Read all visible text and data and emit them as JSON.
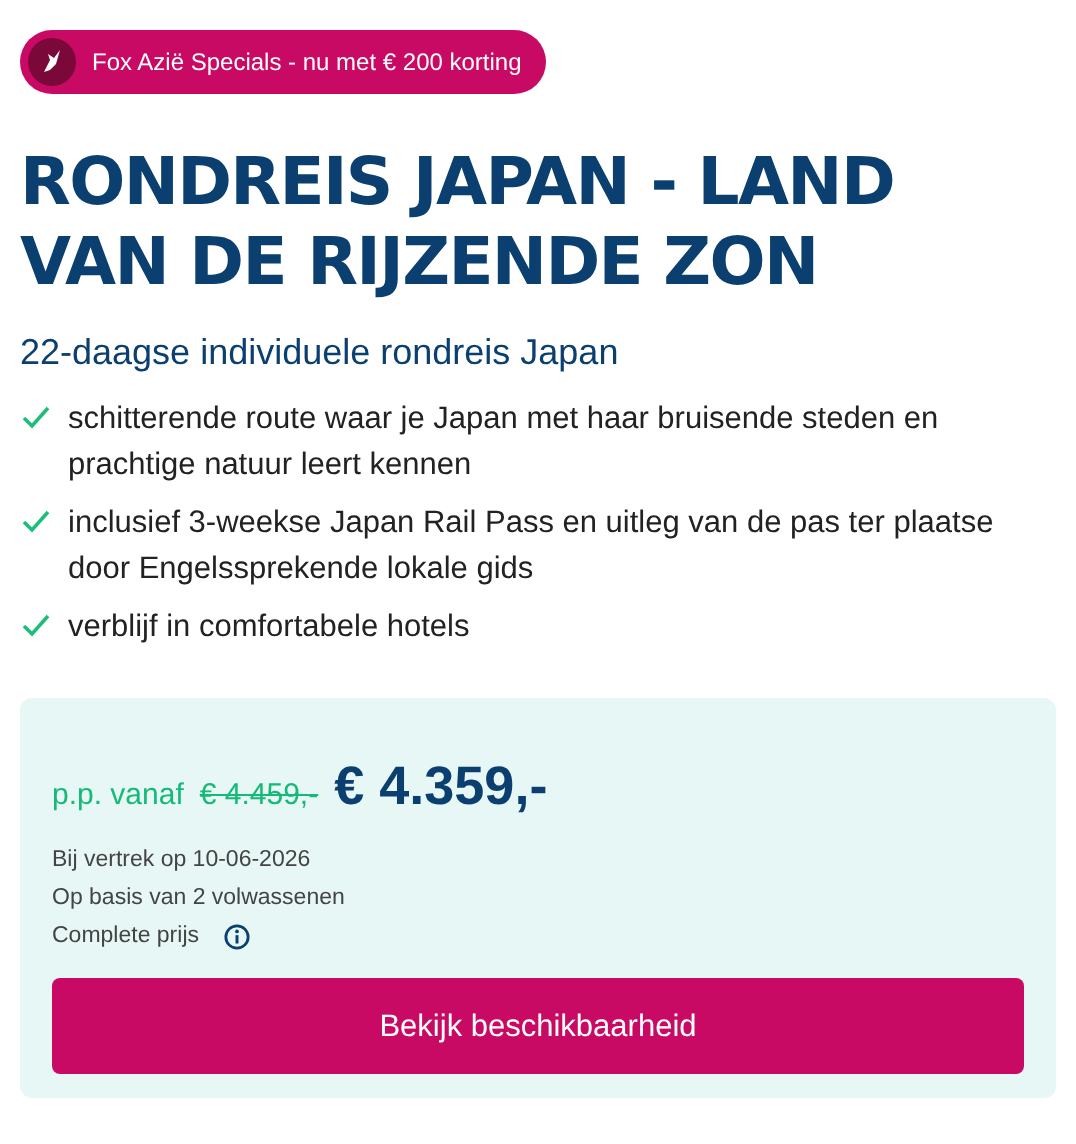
{
  "badge": {
    "label": "Fox Azië Specials - nu met € 200 korting"
  },
  "title": "RONDREIS JAPAN - LAND VAN DE RIJZENDE ZON",
  "subtitle": "22-daagse individuele rondreis Japan",
  "features": [
    "schitterende route waar je Japan met haar bruisende steden en prachtige natuur leert kennen",
    "inclusief 3-weekse Japan Rail Pass en uitleg van de pas ter plaatse door Engelssprekende lokale gids",
    "verblijf in comfortabele hotels"
  ],
  "price": {
    "prefix": "p.p. vanaf",
    "old_price": "€ 4.459,-",
    "new_price": "€ 4.359,-",
    "details": [
      "Bij vertrek op 10-06-2026",
      "Op basis van 2 volwassenen",
      "Complete prijs"
    ],
    "button": "Bekijk beschikbaarheid"
  }
}
